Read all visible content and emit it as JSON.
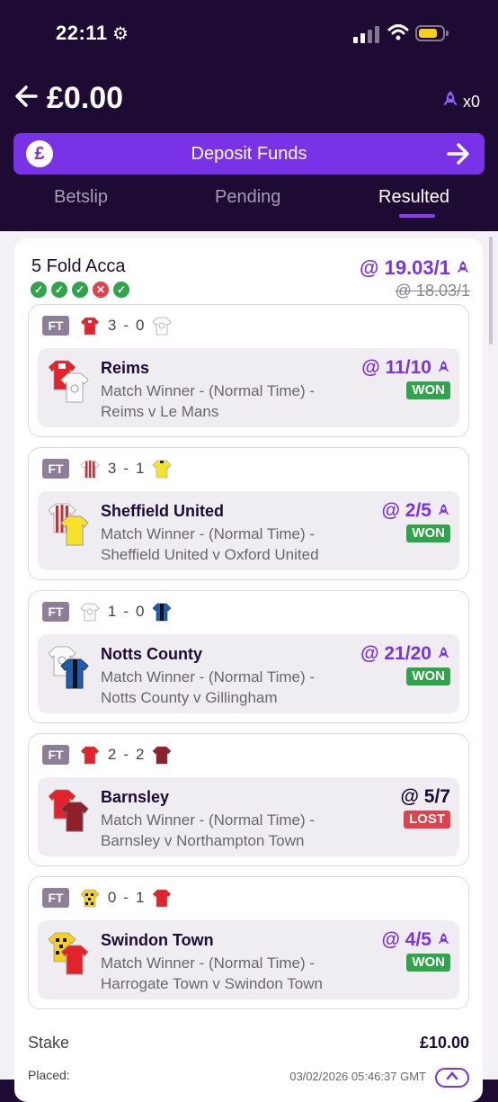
{
  "status_bar": {
    "time": "22:11"
  },
  "header": {
    "balance": "£0.00",
    "boost_count": "x0",
    "deposit": {
      "icon_text": "£",
      "label": "Deposit Funds"
    },
    "tabs": [
      {
        "label": "Betslip"
      },
      {
        "label": "Pending"
      },
      {
        "label": "Resulted"
      }
    ]
  },
  "bet": {
    "title": "5 Fold Acca",
    "odds": "@ 19.03/1",
    "old_odds": "@ 18.03/1",
    "leg_results": [
      "✓",
      "✓",
      "✓",
      "✕",
      "✓"
    ],
    "legs": [
      {
        "ft": "FT",
        "home_score": "3",
        "away_score": "0",
        "team": "Reims",
        "market": "Match Winner - (Normal Time) -",
        "fixture": "Reims v Le Mans",
        "odds": "@ 11/10",
        "result": "WON"
      },
      {
        "ft": "FT",
        "home_score": "3",
        "away_score": "1",
        "team": "Sheffield United",
        "market": "Match Winner - (Normal Time) -",
        "fixture": "Sheffield United v Oxford United",
        "odds": "@ 2/5",
        "result": "WON"
      },
      {
        "ft": "FT",
        "home_score": "1",
        "away_score": "0",
        "team": "Notts County",
        "market": "Match Winner - (Normal Time) -",
        "fixture": "Notts County v Gillingham",
        "odds": "@ 21/20",
        "result": "WON"
      },
      {
        "ft": "FT",
        "home_score": "2",
        "away_score": "2",
        "team": "Barnsley",
        "market": "Match Winner - (Normal Time) -",
        "fixture": "Barnsley v Northampton Town",
        "odds": "@ 5/7",
        "result": "LOST"
      },
      {
        "ft": "FT",
        "home_score": "0",
        "away_score": "1",
        "team": "Swindon Town",
        "market": "Match Winner - (Normal Time) -",
        "fixture": "Harrogate Town v Swindon Town",
        "odds": "@ 4/5",
        "result": "WON"
      }
    ],
    "score_separator": "-",
    "stake_label": "Stake",
    "stake_value": "£10.00",
    "placed_label": "Placed:",
    "placed_value": "03/02/2026 05:46:37 GMT"
  },
  "colors": {
    "accent": "#7a32e6",
    "header_bg": "#1d0b33",
    "won": "#2fa44a",
    "lost": "#e2404a"
  }
}
